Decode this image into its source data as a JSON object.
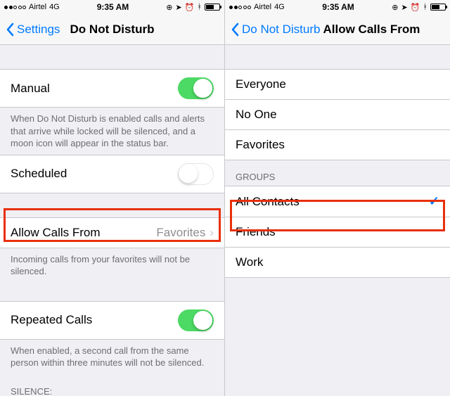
{
  "status": {
    "carrier": "Airtel",
    "network": "4G",
    "time": "9:35 AM"
  },
  "left": {
    "back": "Settings",
    "title": "Do Not Disturb",
    "cells": {
      "manual": "Manual",
      "scheduled": "Scheduled",
      "allow": "Allow Calls From",
      "allow_value": "Favorites",
      "repeated": "Repeated Calls"
    },
    "notes": {
      "manual": "When Do Not Disturb is enabled calls and alerts that arrive while locked will be silenced, and a moon icon will appear in the status bar.",
      "allow": "Incoming calls from your favorites will not be silenced.",
      "repeated": "When enabled, a second call from the same person within three minutes will not be silenced."
    },
    "silence_header": "SILENCE:"
  },
  "right": {
    "back": "Do Not Disturb",
    "title": "Allow Calls From",
    "rows": {
      "everyone": "Everyone",
      "noone": "No One",
      "favorites": "Favorites"
    },
    "groups_header": "GROUPS",
    "groups": {
      "all": "All Contacts",
      "friends": "Friends",
      "work": "Work"
    }
  }
}
